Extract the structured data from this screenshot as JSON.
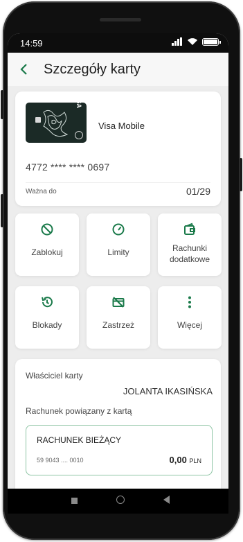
{
  "status_bar": {
    "time": "14:59"
  },
  "header": {
    "title": "Szczegóły karty"
  },
  "card": {
    "name": "Visa Mobile",
    "brand": "VISA",
    "number": "4772 **** **** 0697",
    "valid_label": "Ważna do",
    "valid_value": "01/29"
  },
  "actions": [
    {
      "label": "Zablokuj",
      "icon": "block-icon"
    },
    {
      "label": "Limity",
      "icon": "gauge-icon"
    },
    {
      "label": "Rachunki dodatkowe",
      "icon": "wallet-icon"
    },
    {
      "label": "Blokady",
      "icon": "history-icon"
    },
    {
      "label": "Zastrzeż",
      "icon": "card-cancel-icon"
    },
    {
      "label": "Więcej",
      "icon": "more-vertical-icon"
    }
  ],
  "owner": {
    "label": "Właściciel karty",
    "name": "JOLANTA IKASIŃSKA",
    "account_label": "Rachunek powiązany z kartą"
  },
  "account": {
    "name": "RACHUNEK BIEŻĄCY",
    "number": "59 9043 .... 0010",
    "balance": "0,00",
    "currency": "PLN"
  },
  "colors": {
    "accent": "#1a7a4a",
    "account_border": "#8cc4a3"
  }
}
